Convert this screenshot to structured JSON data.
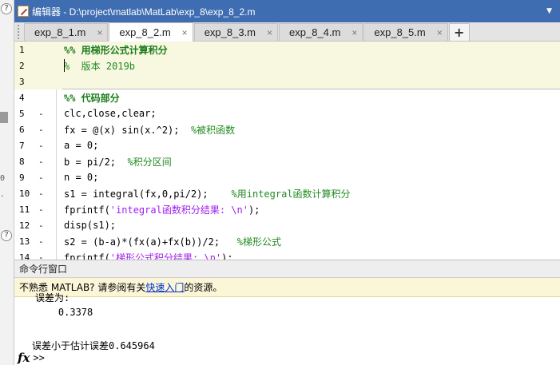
{
  "editor": {
    "title": "编辑器 - D:\\project\\matlab\\MatLab\\exp_8\\exp_8_2.m",
    "tabs": [
      {
        "label": "exp_8_1.m",
        "active": false
      },
      {
        "label": "exp_8_2.m",
        "active": true
      },
      {
        "label": "exp_8_3.m",
        "active": false
      },
      {
        "label": "exp_8_4.m",
        "active": false
      },
      {
        "label": "exp_8_5.m",
        "active": false
      }
    ],
    "tab_close_glyph": "×",
    "add_tab_glyph": "+",
    "lines": [
      {
        "n": "1",
        "bp": "",
        "parts": [
          {
            "t": "%% 用梯形公式计算积分",
            "c": "kw-sec"
          }
        ]
      },
      {
        "n": "2",
        "bp": "",
        "parts": [
          {
            "t": "%  版本 2019b",
            "c": "cm"
          }
        ]
      },
      {
        "n": "3",
        "bp": "",
        "parts": []
      },
      {
        "n": "4",
        "bp": "",
        "parts": [
          {
            "t": "%% 代码部分",
            "c": "kw-sec"
          }
        ]
      },
      {
        "n": "5",
        "bp": "-",
        "parts": [
          {
            "t": "clc,close,clear;",
            "c": ""
          }
        ]
      },
      {
        "n": "6",
        "bp": "-",
        "parts": [
          {
            "t": "fx = @(x) sin(x.^2);  ",
            "c": ""
          },
          {
            "t": "%被积函数",
            "c": "cm"
          }
        ]
      },
      {
        "n": "7",
        "bp": "-",
        "parts": [
          {
            "t": "a = 0;",
            "c": ""
          }
        ]
      },
      {
        "n": "8",
        "bp": "-",
        "parts": [
          {
            "t": "b = pi/2;  ",
            "c": ""
          },
          {
            "t": "%积分区间",
            "c": "cm"
          }
        ]
      },
      {
        "n": "9",
        "bp": "-",
        "parts": [
          {
            "t": "n = 0;",
            "c": ""
          }
        ]
      },
      {
        "n": "10",
        "bp": "-",
        "parts": [
          {
            "t": "s1 = integral(fx,0,pi/2);    ",
            "c": ""
          },
          {
            "t": "%用integral函数计算积分",
            "c": "cm"
          }
        ]
      },
      {
        "n": "11",
        "bp": "-",
        "parts": [
          {
            "t": "fprintf(",
            "c": ""
          },
          {
            "t": "'integral函数积分结果: \\n'",
            "c": "str"
          },
          {
            "t": ");",
            "c": ""
          }
        ]
      },
      {
        "n": "12",
        "bp": "-",
        "parts": [
          {
            "t": "disp(s1);",
            "c": ""
          }
        ]
      },
      {
        "n": "13",
        "bp": "-",
        "parts": [
          {
            "t": "s2 = (b-a)*(fx(a)+fx(b))/2;   ",
            "c": ""
          },
          {
            "t": "%梯形公式",
            "c": "cm"
          }
        ]
      },
      {
        "n": "14",
        "bp": "-",
        "parts": [
          {
            "t": "fprintf(",
            "c": ""
          },
          {
            "t": "'梯形公式积分结果: \\n'",
            "c": "str"
          },
          {
            "t": ");",
            "c": ""
          }
        ]
      }
    ]
  },
  "command_window": {
    "title": "命令行窗口",
    "tip_prefix": "不熟悉 MATLAB? 请参阅有关",
    "tip_link": "快速入门",
    "tip_suffix": "的资源。",
    "output": [
      "误差为:",
      "    0.3378",
      "",
      "误差小于估计误差0.645964"
    ],
    "prompt_fx": "fx",
    "prompt": ">>"
  },
  "colors": {
    "title_bar": "#3f6db1",
    "section_background": "#f8f7e0",
    "comment": "#228b22",
    "string": "#a020f0",
    "tip_background": "#fbf6d8",
    "link": "#0033cc"
  },
  "icons": {
    "app": "matlab-editor-icon",
    "collapse": "collapse-triangle-icon",
    "help": "help-circle-icon"
  },
  "left_panel": {
    "ticks": [
      "0",
      "."
    ]
  }
}
